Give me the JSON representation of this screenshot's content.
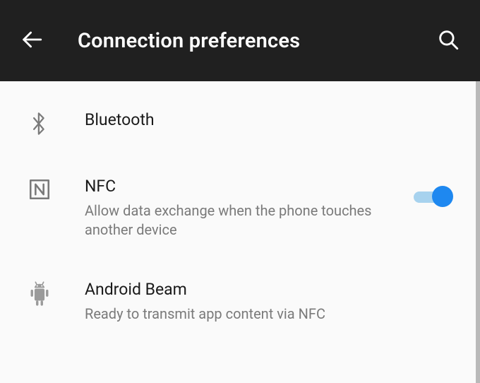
{
  "header": {
    "title": "Connection preferences"
  },
  "items": [
    {
      "title": "Bluetooth",
      "subtitle": null,
      "toggle": null
    },
    {
      "title": "NFC",
      "subtitle": "Allow data exchange when the phone touches another device",
      "toggle": true
    },
    {
      "title": "Android Beam",
      "subtitle": "Ready to transmit app content via NFC",
      "toggle": null
    }
  ]
}
